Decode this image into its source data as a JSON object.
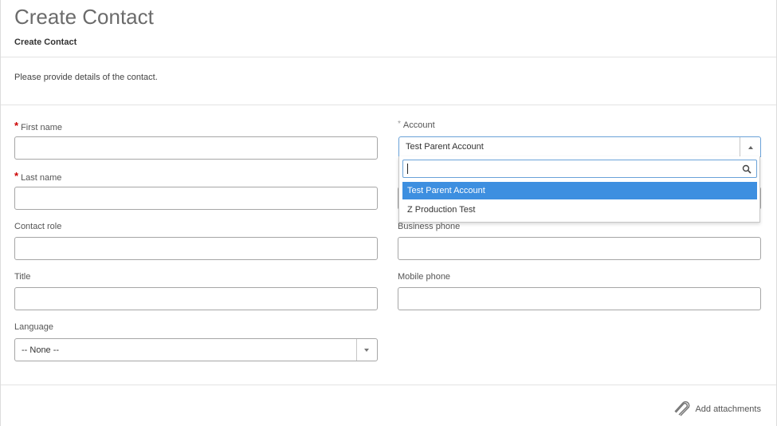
{
  "header": {
    "title": "Create Contact",
    "subtitle": "Create Contact"
  },
  "description": "Please provide details of the contact.",
  "fields": {
    "first_name": {
      "label": "First name",
      "required_mark": "*",
      "value": ""
    },
    "last_name": {
      "label": "Last name",
      "required_mark": "*",
      "value": ""
    },
    "contact_role": {
      "label": "Contact role",
      "value": ""
    },
    "title": {
      "label": "Title",
      "value": ""
    },
    "language": {
      "label": "Language",
      "value": "-- None --"
    },
    "account": {
      "label": "Account",
      "required_mark": "*",
      "value": "Test Parent Account"
    },
    "business_phone": {
      "label": "Business phone",
      "value": ""
    },
    "mobile_phone": {
      "label": "Mobile phone",
      "value": ""
    }
  },
  "account_dropdown": {
    "search_value": "",
    "options": [
      "Test Parent Account",
      "Z Production Test"
    ],
    "highlighted": "Test Parent Account"
  },
  "footer": {
    "attach_label": "Add attachments"
  },
  "icons": {
    "search": "search-icon",
    "attach": "paperclip-icon",
    "dropdown": "chevron-down-icon"
  },
  "colors": {
    "required": "#cc0000",
    "highlight": "#3d8fe0",
    "focus_border": "#6aa2d8"
  }
}
